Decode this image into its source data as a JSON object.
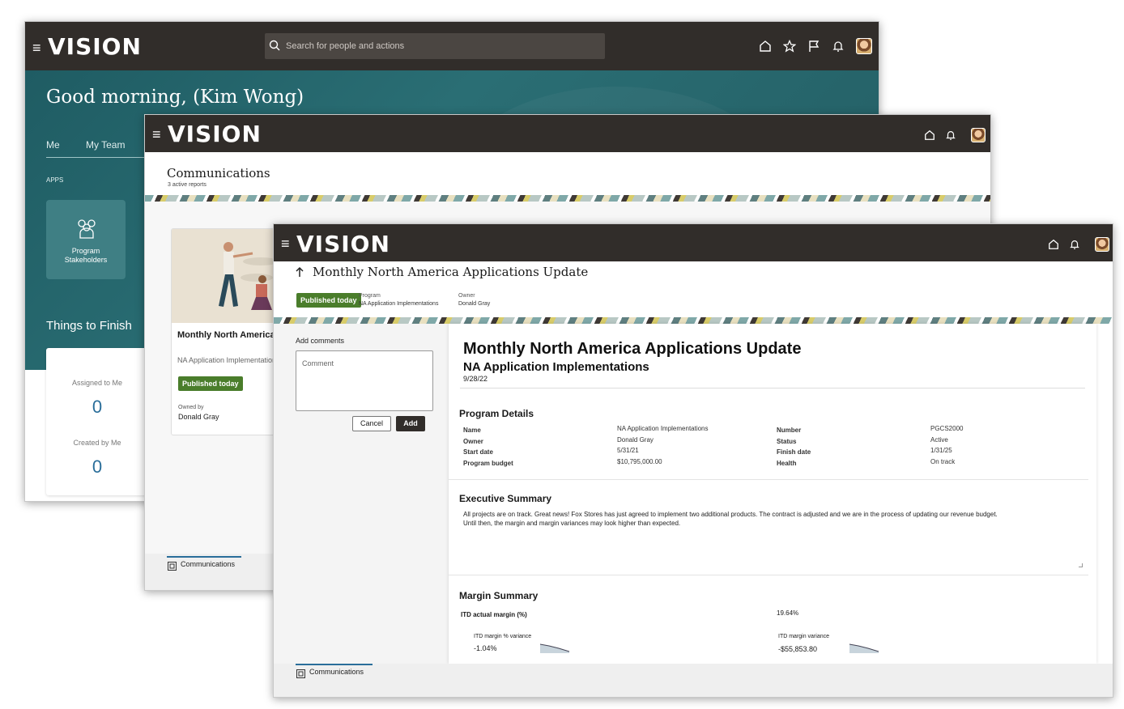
{
  "app": {
    "logo": "VISION"
  },
  "win1": {
    "search_placeholder": "Search for people and actions",
    "greeting": "Good morning, (Kim Wong)",
    "tabs": [
      "Me",
      "My Team"
    ],
    "apps_label": "APPS",
    "app_tile_label": "Program Stakeholders",
    "things_title": "Things to Finish",
    "assigned_label": "Assigned to Me",
    "assigned_count": "0",
    "created_label": "Created by Me",
    "created_count": "0"
  },
  "win2": {
    "page_title": "Communications",
    "subtitle": "3 active reports",
    "card": {
      "title": "Monthly North America Applications Update",
      "program": "NA Application Implementations",
      "badge": "Published today",
      "owned_by_label": "Owned by",
      "owner": "Donald Gray"
    },
    "footer_tab": "Communications"
  },
  "win3": {
    "header_title": "Monthly North America Applications Update",
    "badge": "Published today",
    "program_label": "Program",
    "program_value": "NA Application Implementations",
    "owner_label": "Owner",
    "owner_value": "Donald Gray",
    "comments": {
      "title": "Add comments",
      "placeholder": "Comment",
      "cancel": "Cancel",
      "add": "Add"
    },
    "report": {
      "title": "Monthly North America Applications Update",
      "subtitle": "NA Application Implementations",
      "date": "9/28/22",
      "details_heading": "Program Details",
      "details_left": [
        {
          "label": "Name",
          "value": "NA Application Implementations"
        },
        {
          "label": "Owner",
          "value": "Donald Gray"
        },
        {
          "label": "Start date",
          "value": "5/31/21"
        },
        {
          "label": "Program budget",
          "value": "$10,795,000.00"
        }
      ],
      "details_right": [
        {
          "label": "Number",
          "value": "PGCS2000"
        },
        {
          "label": "Status",
          "value": "Active"
        },
        {
          "label": "Finish date",
          "value": "1/31/25"
        },
        {
          "label": "Health",
          "value": "On track"
        }
      ],
      "exec_heading": "Executive Summary",
      "exec_text_1": "All projects are on track. Great news! Fox Stores has just agreed to implement two additional products. The contract is adjusted and we are in the process of updating our revenue budget.",
      "exec_text_2": "Until then, the margin and margin variances may look higher than expected.",
      "margin_heading": "Margin Summary",
      "itd_label": "ITD actual margin (%)",
      "itd_value": "19.64%",
      "pct_var_label": "ITD margin % variance",
      "pct_var_value": "-1.04%",
      "var_label": "ITD margin variance",
      "var_value": "-$55,853.80"
    },
    "footer_tab": "Communications"
  }
}
